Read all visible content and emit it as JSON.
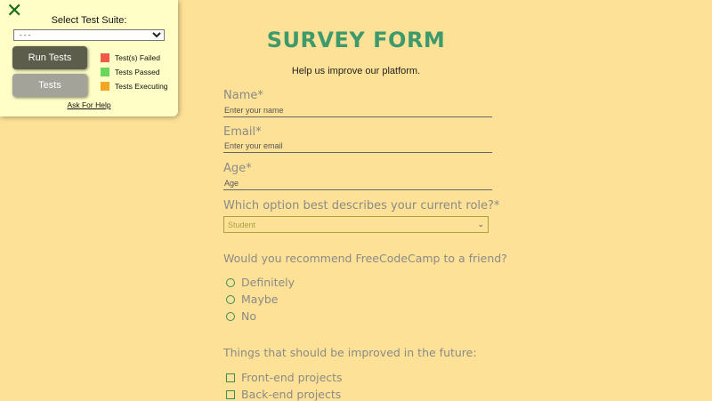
{
  "test_panel": {
    "close_icon": "close-x-icon",
    "suite_label": "Select Test Suite:",
    "suite_selected": "- - -",
    "run_tests_label": "Run Tests",
    "tests_label": "Tests",
    "legend": [
      {
        "label": "Test(s) Failed",
        "color": "#ee5a45"
      },
      {
        "label": "Tests Passed",
        "color": "#67d65a"
      },
      {
        "label": "Tests Executing",
        "color": "#f2a623"
      }
    ],
    "help_link": "Ask For Help"
  },
  "form": {
    "title": "SURVEY FORM",
    "subtitle": "Help us improve our platform.",
    "name": {
      "label": "Name*",
      "placeholder": "Enter your name"
    },
    "email": {
      "label": "Email*",
      "placeholder": "Enter your email"
    },
    "age": {
      "label": "Age*",
      "placeholder": "Age"
    },
    "role": {
      "label": "Which option best describes your current role?*",
      "selected": "Student"
    },
    "recommend": {
      "question": "Would you recommend FreeCodeCamp to a friend?",
      "options": [
        "Definitely",
        "Maybe",
        "No"
      ]
    },
    "improve": {
      "question": "Things that should be improved in the future:",
      "options": [
        "Front-end projects",
        "Back-end projects"
      ]
    }
  }
}
